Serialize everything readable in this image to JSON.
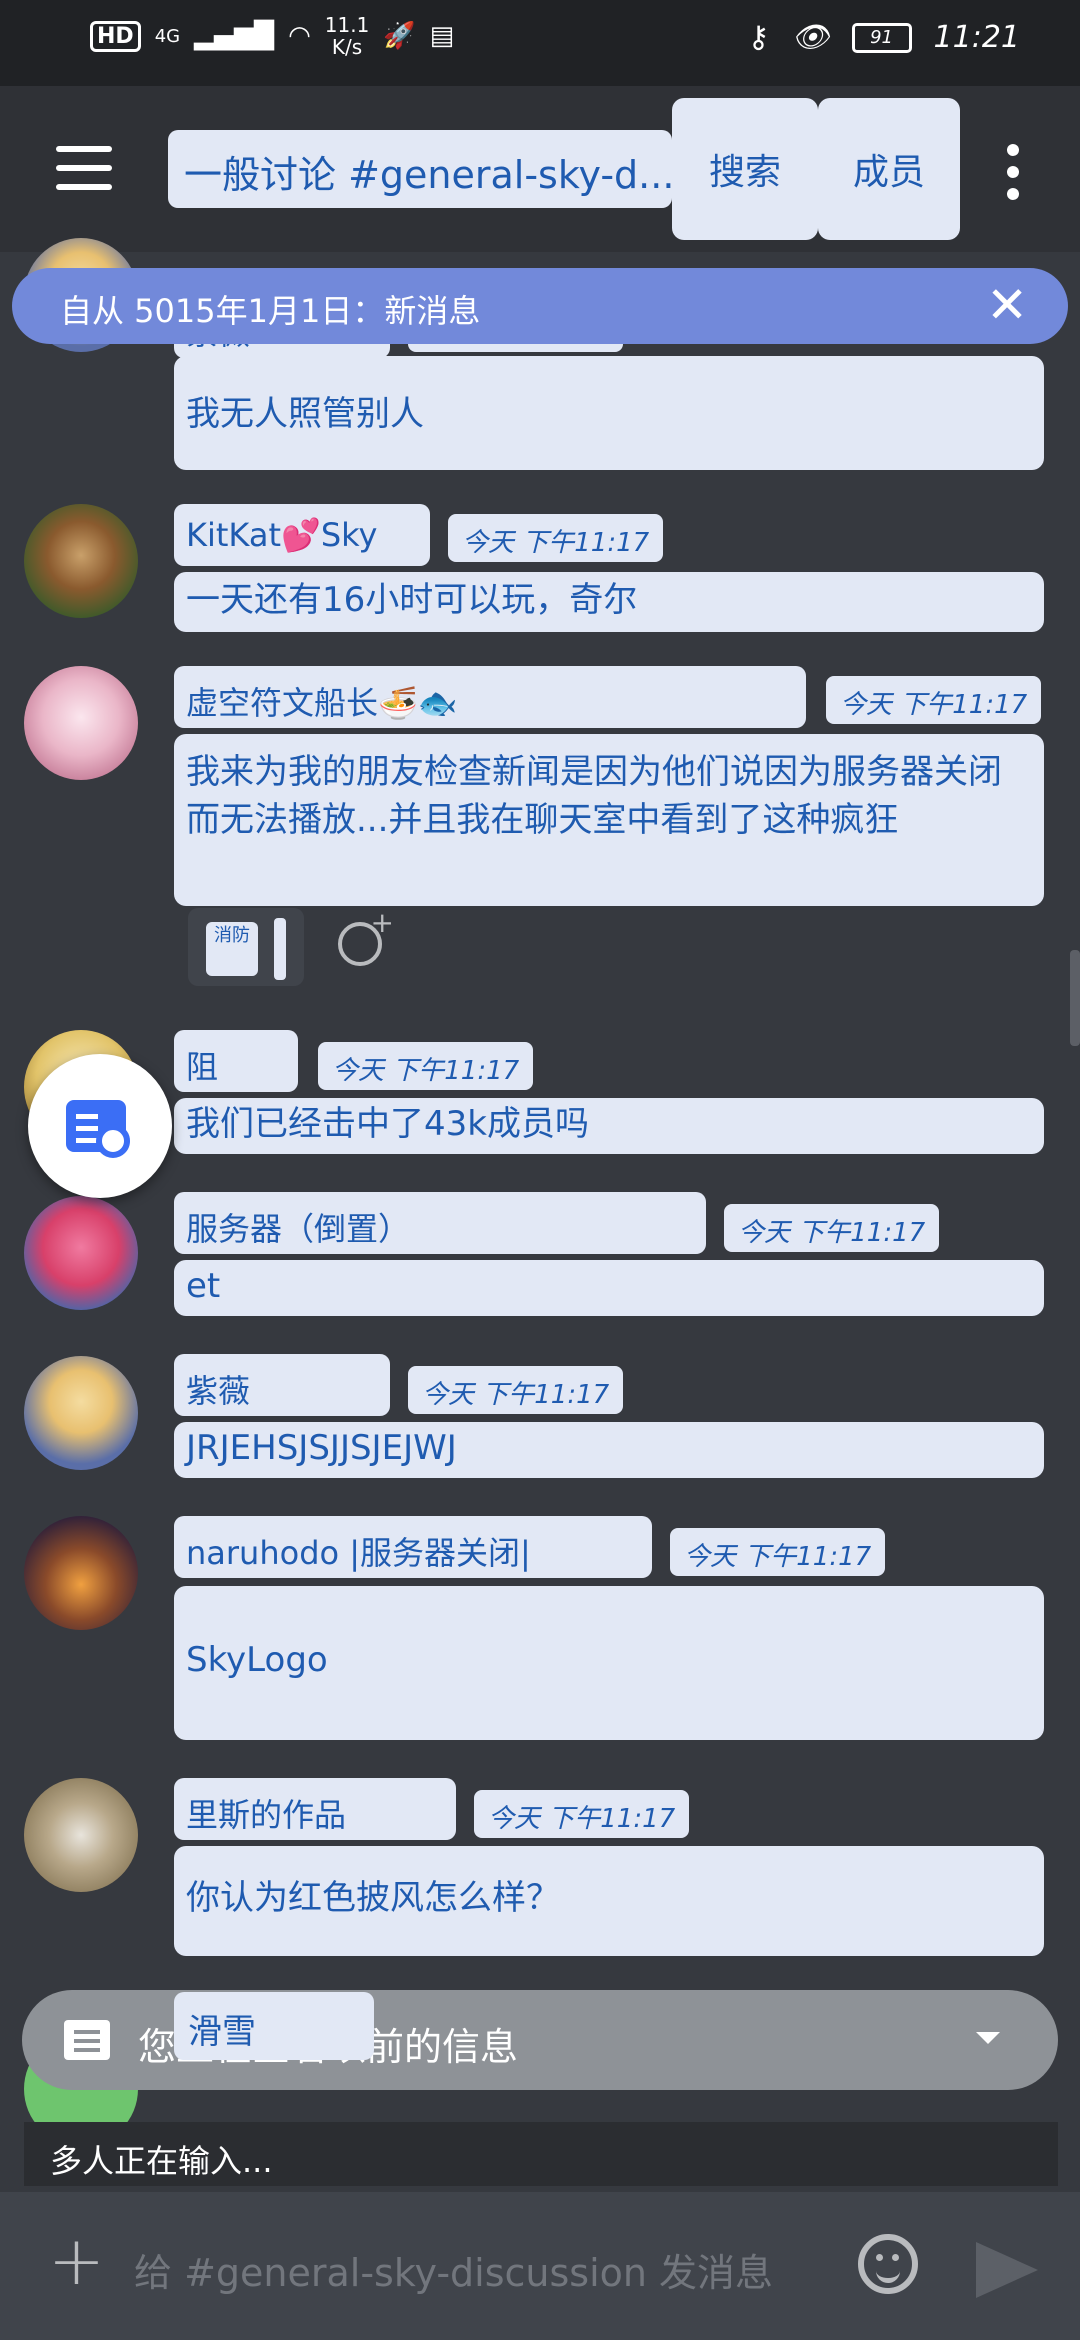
{
  "status_bar": {
    "hd": "HD",
    "network": "4G",
    "speed_value": "11.1",
    "speed_unit": "K/s",
    "battery": "91",
    "time": "11:21"
  },
  "header": {
    "channel": "一般讨论 #general-sky-d...",
    "search_label": "搜索",
    "members_label": "成员"
  },
  "new_banner": {
    "text": "自从 5015年1月1日：新消息"
  },
  "messages": [
    {
      "name": "紫薇",
      "time": "今天 下午11:17",
      "text": "我无人照管别人"
    },
    {
      "name": "KitKat💕Sky",
      "time": "今天 下午11:17",
      "text": "一天还有16小时可以玩，奇尔"
    },
    {
      "name": "虚空符文船长🍜🐟",
      "time": "今天 下午11:17",
      "text": "我来为我的朋友检查新闻是因为他们说因为服务器关闭而无法播放...并且我在聊天室中看到了这种疯狂"
    },
    {
      "name": "阻",
      "time": "今天 下午11:17",
      "text": "我们已经击中了43k成员吗"
    },
    {
      "name": "服务器（倒置）",
      "time": "今天 下午11:17",
      "text": "et"
    },
    {
      "name": "紫薇",
      "time": "今天 下午11:17",
      "text": "JRJEHSJSJJSJEJWJ"
    },
    {
      "name": "naruhodo |服务器关闭|",
      "time": "今天 下午11:17",
      "text": "SkyLogo"
    },
    {
      "name": "里斯的作品",
      "time": "今天 下午11:17",
      "text": "你认为红色披风怎么样？"
    }
  ],
  "reaction": {
    "chip": "消防"
  },
  "last_message": {
    "name": "滑雪"
  },
  "history_banner": {
    "text": "您正在查看以前的信息"
  },
  "typing": {
    "text": "多人正在输入..."
  },
  "composer": {
    "placeholder": "给 #general-sky-discussion 发消息"
  },
  "colors": {
    "background": "#36393f",
    "header": "#2f3136",
    "banner": "#7289da",
    "pill": "#e2e8f5",
    "pill_text": "#1f5bb0"
  }
}
